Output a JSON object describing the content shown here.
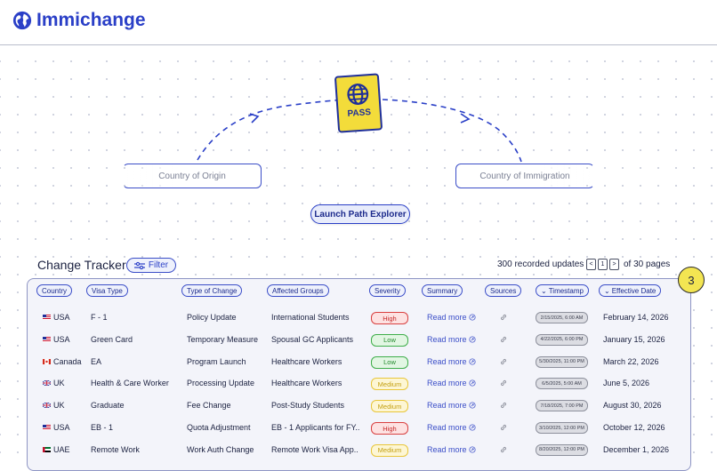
{
  "app": {
    "title": "Immichange"
  },
  "map": {
    "origin_label": "Country of Origin",
    "immigration_label": "Country of Immigration",
    "launch_label": "Launch Path Explorer",
    "passport_label": "PASS"
  },
  "tracker": {
    "title": "Change Tracker",
    "filter_label": "Filter",
    "updates_text": "300 recorded updates",
    "page_prev": "<",
    "page_current": "1",
    "page_next": ">",
    "page_total_text": "of 30 pages",
    "step_badge": "3",
    "columns": [
      "Country",
      "Visa Type",
      "Type of Change",
      "Affected Groups",
      "Severity",
      "Summary",
      "Sources",
      "Timestamp",
      "Effective Date"
    ],
    "read_more_label": "Read more",
    "rows": [
      {
        "country": "USA",
        "flag": "us",
        "visa": "F - 1",
        "change": "Policy Update",
        "groups": "International Students",
        "severity": "High",
        "timestamp": "2/15/2025, 6:00 AM",
        "effective": "February 14, 2026"
      },
      {
        "country": "USA",
        "flag": "us",
        "visa": "Green Card",
        "change": "Temporary Measure",
        "groups": "Spousal GC Applicants",
        "severity": "Low",
        "timestamp": "4/22/2025, 6:00 PM",
        "effective": "January 15, 2026"
      },
      {
        "country": "Canada",
        "flag": "ca",
        "visa": "EA",
        "change": "Program Launch",
        "groups": "Healthcare Workers",
        "severity": "Low",
        "timestamp": "5/30/2025, 11:00 PM",
        "effective": "March 22, 2026"
      },
      {
        "country": "UK",
        "flag": "uk",
        "visa": "Health & Care Worker",
        "change": "Processing Update",
        "groups": "Healthcare Workers",
        "severity": "Medium",
        "timestamp": "6/5/2025, 5:00 AM",
        "effective": "June 5, 2026"
      },
      {
        "country": "UK",
        "flag": "uk",
        "visa": "Graduate",
        "change": "Fee Change",
        "groups": "Post-Study Students",
        "severity": "Medium",
        "timestamp": "7/18/2025, 7:00 PM",
        "effective": "August 30, 2026"
      },
      {
        "country": "USA",
        "flag": "us",
        "visa": "EB - 1",
        "change": "Quota Adjustment",
        "groups": "EB - 1 Applicants for FY..",
        "severity": "High",
        "timestamp": "3/10/2025, 12:00 PM",
        "effective": "October 12, 2026"
      },
      {
        "country": "UAE",
        "flag": "ae",
        "visa": "Remote Work",
        "change": "Work Auth Change",
        "groups": "Remote Work Visa App..",
        "severity": "Medium",
        "timestamp": "8/20/2025, 12:00 PM",
        "effective": "December 1, 2026"
      }
    ]
  },
  "colors": {
    "accent": "#2a3fc7",
    "passport": "#f3dc3a",
    "high": "#d94040",
    "low": "#3fae4a",
    "medium": "#e8c63a"
  }
}
